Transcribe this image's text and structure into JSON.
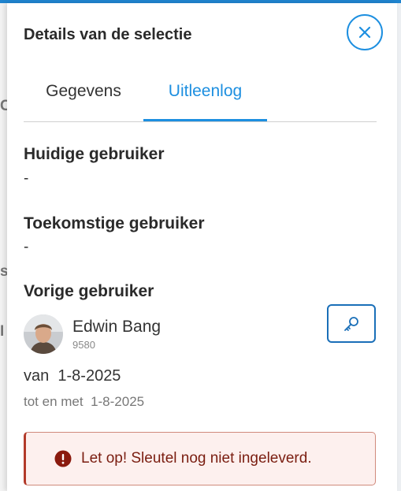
{
  "panel": {
    "title": "Details van de selectie",
    "close_icon": "close-icon"
  },
  "tabs": [
    {
      "label": "Gegevens",
      "active": false
    },
    {
      "label": "Uitleenlog",
      "active": true
    }
  ],
  "current_user": {
    "heading": "Huidige gebruiker",
    "value": "-"
  },
  "future_user": {
    "heading": "Toekomstige gebruiker",
    "value": "-"
  },
  "previous_user": {
    "heading": "Vorige gebruiker",
    "name": "Edwin Bang",
    "id": "9580",
    "avatar_icon": "avatar",
    "action_icon": "key-icon",
    "from_label": "van",
    "from_date": "1-8-2025",
    "to_label": "tot en met",
    "to_date": "1-8-2025"
  },
  "alert": {
    "icon": "exclamation-icon",
    "text": "Let op! Sleutel nog niet ingeleverd."
  },
  "colors": {
    "accent": "#1d8fe0",
    "alert_bg": "#fdf0ee",
    "alert_text": "#7a1d10"
  }
}
